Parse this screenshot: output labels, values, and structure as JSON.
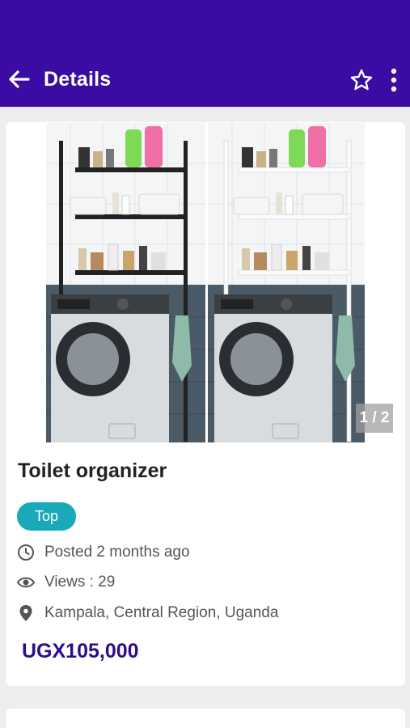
{
  "header": {
    "title": "Details",
    "background": "#3a0ca3",
    "icons": [
      "back-arrow-icon",
      "star-outline-icon",
      "more-vertical-icon"
    ]
  },
  "gallery": {
    "counter": "1 / 2",
    "images": [
      "over-washer-shelf-black",
      "over-washer-shelf-white"
    ]
  },
  "listing": {
    "title": "Toilet organizer",
    "badge": "Top",
    "badge_color": "#1aa9b8",
    "posted": "Posted 2 months ago",
    "views": "Views : 29",
    "location": "Kampala, Central Region, Uganda",
    "price": "UGX105,000",
    "price_color": "#2f0b8a",
    "icons": [
      "clock-icon",
      "eye-icon",
      "map-pin-icon"
    ]
  }
}
